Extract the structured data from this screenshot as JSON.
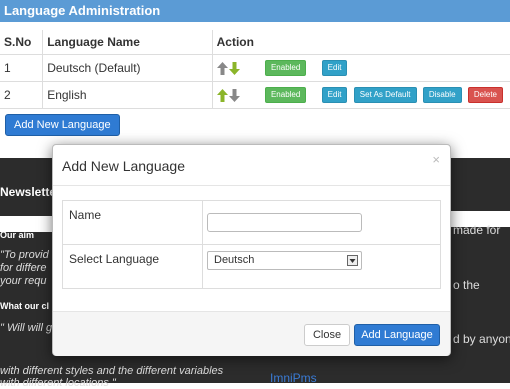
{
  "header": {
    "title": "Language Administration"
  },
  "table": {
    "columns": [
      "S.No",
      "Language Name",
      "Action"
    ],
    "rows": [
      {
        "sno": "1",
        "name": "Deutsch (Default)",
        "status": "Enabled",
        "edit": "Edit"
      },
      {
        "sno": "2",
        "name": "English",
        "status": "Enabled",
        "edit": "Edit",
        "set_default": "Set As Default",
        "disable": "Disable",
        "delete": "Delete"
      }
    ]
  },
  "add_new_button": "Add New Language",
  "background": {
    "newsletter": "Newslette",
    "made_for": "made for",
    "our_aim": "Our aim",
    "quote1": "\"To provid",
    "quote2": "for differe",
    "quote3": "your requ",
    "what_our": "What our cl",
    "to": "o the",
    "will": "\" Will will g",
    "styles": "with different styles and the different variables",
    "locations": "with different locations \"",
    "by_anyone": "d by anyone",
    "brand": "ImniPms"
  },
  "modal": {
    "title": "Add New Language",
    "close_icon": "×",
    "name_label": "Name",
    "name_value": "",
    "select_label": "Select Language",
    "select_value": "Deutsch",
    "close_button": "Close",
    "add_button": "Add Language"
  },
  "colors": {
    "header": "#5b9bd5",
    "primary": "#2f7bd3",
    "enabled": "#5cb85c",
    "info": "#31a1c8",
    "danger": "#d9534f",
    "arrow_active": "#8bb52a",
    "arrow_inactive": "#888888"
  }
}
